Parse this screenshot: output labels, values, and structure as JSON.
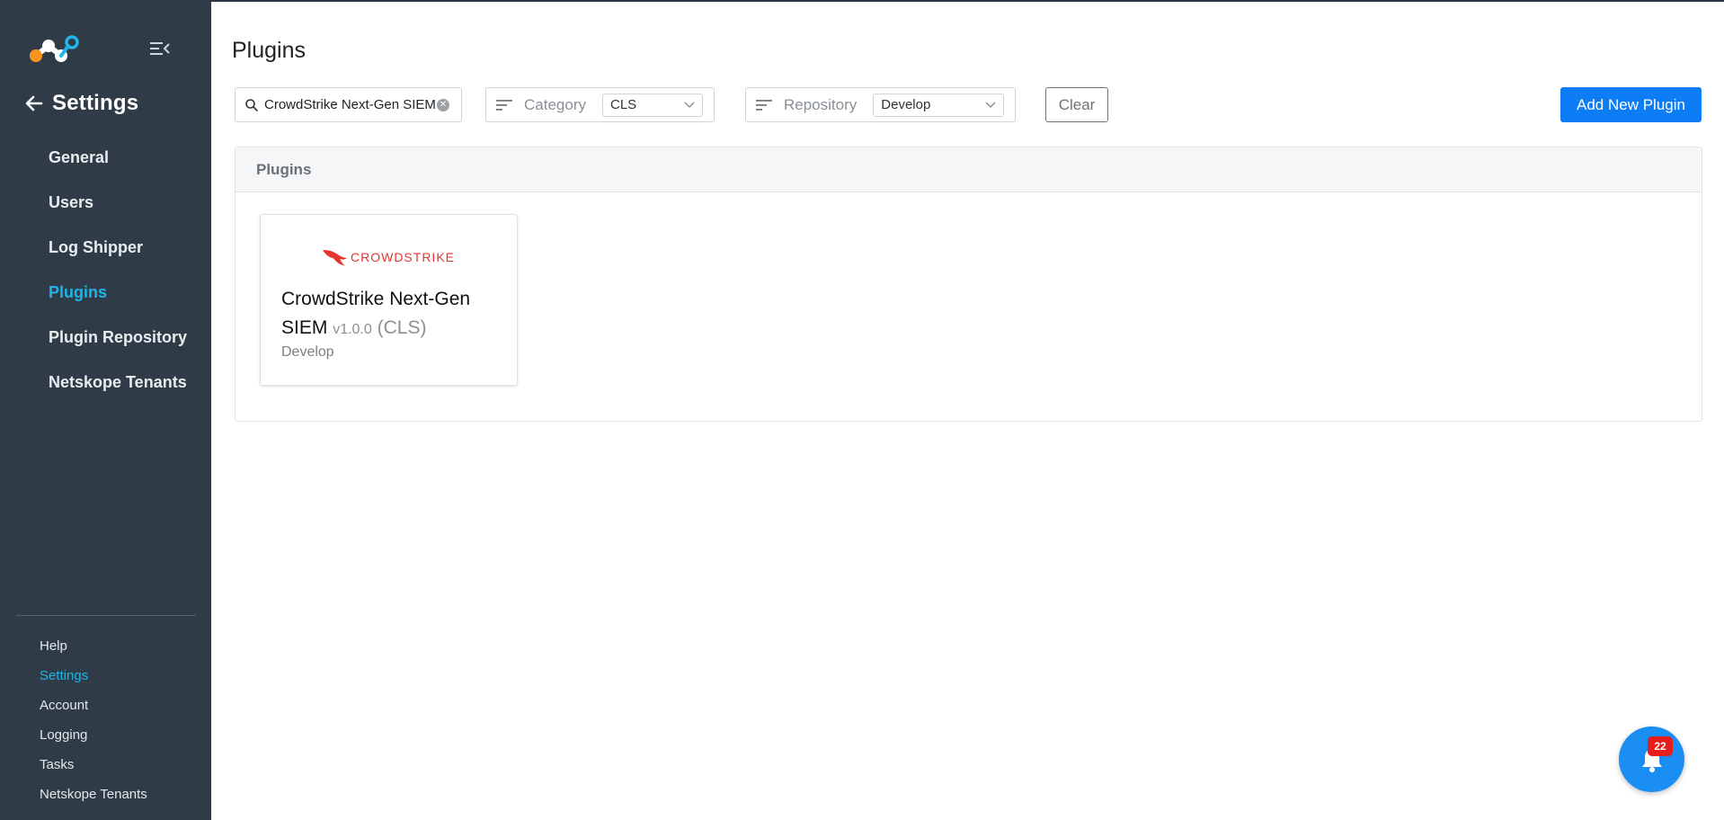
{
  "sidebar": {
    "section_title": "Settings",
    "items": [
      {
        "label": "General",
        "active": false
      },
      {
        "label": "Users",
        "active": false
      },
      {
        "label": "Log Shipper",
        "active": false
      },
      {
        "label": "Plugins",
        "active": true
      },
      {
        "label": "Plugin Repository",
        "active": false
      },
      {
        "label": "Netskope Tenants",
        "active": false
      }
    ],
    "bottom_items": [
      {
        "label": "Help",
        "active": false
      },
      {
        "label": "Settings",
        "active": true
      },
      {
        "label": "Account",
        "active": false
      },
      {
        "label": "Logging",
        "active": false
      },
      {
        "label": "Tasks",
        "active": false
      },
      {
        "label": "Netskope Tenants",
        "active": false
      }
    ]
  },
  "page": {
    "title": "Plugins"
  },
  "toolbar": {
    "search_value": "CrowdStrike Next-Gen SIEM",
    "category_label": "Category",
    "category_value": "CLS",
    "repository_label": "Repository",
    "repository_value": "Develop",
    "clear_label": "Clear",
    "add_label": "Add New Plugin"
  },
  "panel": {
    "title": "Plugins",
    "cards": [
      {
        "brand": "CROWDSTRIKE",
        "name": "CrowdStrike Next-Gen SIEM",
        "version": "v1.0.0",
        "category": "(CLS)",
        "repository": "Develop"
      }
    ]
  },
  "notifications": {
    "count": "22"
  },
  "colors": {
    "sidebar_bg": "#2f3c48",
    "accent": "#1fb5e6",
    "primary_button": "#0d7df6",
    "brand_red": "#e5342e",
    "badge": "#e71d1d"
  }
}
